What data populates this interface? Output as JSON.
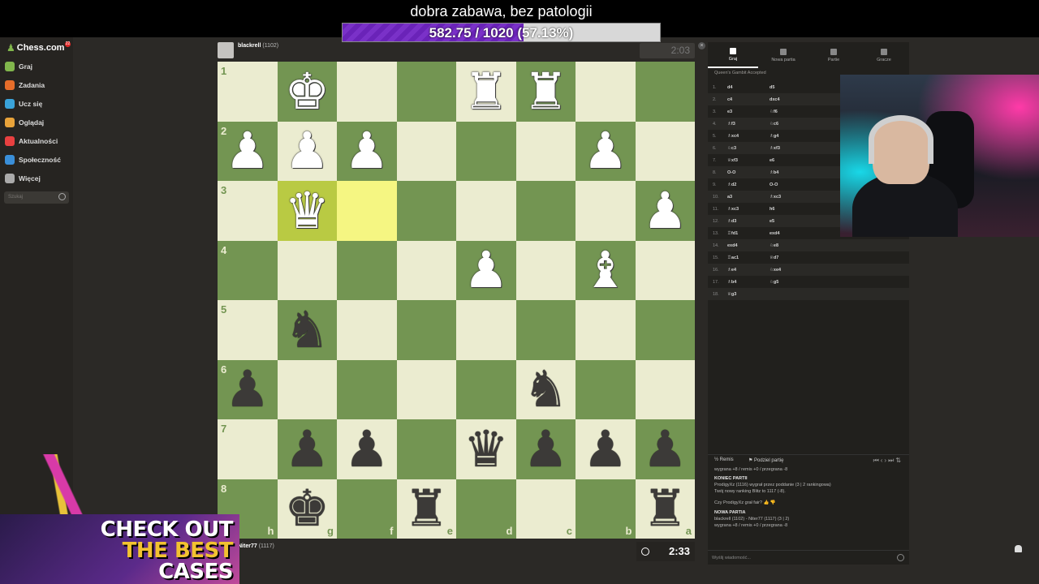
{
  "banner": {
    "title": "dobra zabawa, bez patologii",
    "goal_text": "582.75 / 1020",
    "goal_percent_label": "(57.13%)",
    "goal_fraction": 0.5713,
    "fill_color": "#6a23b8"
  },
  "sidebar": {
    "logo": "Chess.com",
    "badge": "22",
    "items": [
      {
        "label": "Graj",
        "icon": "pawn-icon",
        "color": "#81b64c"
      },
      {
        "label": "Zadania",
        "icon": "puzzle-icon",
        "color": "#e66d2a"
      },
      {
        "label": "Ucz się",
        "icon": "lesson-icon",
        "color": "#3aa3d9"
      },
      {
        "label": "Oglądaj",
        "icon": "watch-icon",
        "color": "#e8a33a"
      },
      {
        "label": "Aktualności",
        "icon": "news-icon",
        "color": "#e84040"
      },
      {
        "label": "Społeczność",
        "icon": "community-icon",
        "color": "#3a8fd9"
      },
      {
        "label": "Więcej",
        "icon": "more-icon",
        "color": "#aaaaaa"
      }
    ],
    "search_placeholder": "Szukaj"
  },
  "top_player": {
    "name": "blackrell",
    "rating": "(1102)",
    "clock": "2:03"
  },
  "bottom_player": {
    "name": "Niter77",
    "rating": "(1117)",
    "clock": "2:33"
  },
  "board": {
    "ranks": [
      "1",
      "2",
      "3",
      "4",
      "5",
      "6",
      "7",
      "8"
    ],
    "files": [
      "h",
      "g",
      "f",
      "e",
      "d",
      "c",
      "b",
      "a"
    ],
    "highlighted": [
      [
        2,
        1
      ],
      [
        2,
        2
      ]
    ],
    "position": [
      [
        "",
        "wK",
        "",
        "",
        "wR",
        "wR",
        "",
        ""
      ],
      [
        "wP",
        "wP",
        "wP",
        "",
        "",
        "",
        "wP",
        ""
      ],
      [
        "",
        "wQ",
        "",
        "",
        "",
        "",
        "",
        "wP"
      ],
      [
        "",
        "",
        "",
        "",
        "wP",
        "",
        "wB",
        ""
      ],
      [
        "",
        "bN",
        "",
        "",
        "",
        "",
        "",
        ""
      ],
      [
        "bP",
        "",
        "",
        "",
        "",
        "bN",
        "",
        ""
      ],
      [
        "",
        "bP",
        "bP",
        "",
        "bQ",
        "bP",
        "bP",
        "bP"
      ],
      [
        "",
        "bK",
        "",
        "bR",
        "",
        "",
        "",
        "bR"
      ]
    ]
  },
  "panel": {
    "tabs": [
      {
        "label": "Graj",
        "icon": "bolt-icon"
      },
      {
        "label": "Nowa partia",
        "icon": "plus-icon"
      },
      {
        "label": "Partie",
        "icon": "games-icon"
      },
      {
        "label": "Gracze",
        "icon": "players-icon"
      }
    ],
    "opening": "Queen's Gambit Accepted",
    "moves": [
      {
        "n": "1.",
        "w": "d4",
        "b": "d5"
      },
      {
        "n": "2.",
        "w": "c4",
        "b": "dxc4"
      },
      {
        "n": "3.",
        "w": "e3",
        "b": "♘f6"
      },
      {
        "n": "4.",
        "w": "♗f3",
        "b": "♘c6"
      },
      {
        "n": "5.",
        "w": "♗xc4",
        "b": "♗g4"
      },
      {
        "n": "6.",
        "w": "♘c3",
        "b": "♗xf3"
      },
      {
        "n": "7.",
        "w": "♕xf3",
        "b": "e6"
      },
      {
        "n": "8.",
        "w": "O-O",
        "b": "♗b4"
      },
      {
        "n": "9.",
        "w": "♗d2",
        "b": "O-O"
      },
      {
        "n": "10.",
        "w": "a3",
        "b": "♗xc3"
      },
      {
        "n": "11.",
        "w": "♗xc3",
        "b": "h6"
      },
      {
        "n": "12.",
        "w": "♗d3",
        "b": "e5"
      },
      {
        "n": "13.",
        "w": "♖fd1",
        "b": "exd4"
      },
      {
        "n": "14.",
        "w": "exd4",
        "b": "♘e8"
      },
      {
        "n": "15.",
        "w": "♖ac1",
        "b": "♕d7"
      },
      {
        "n": "16.",
        "w": "♗e4",
        "b": "♘xe4"
      },
      {
        "n": "17.",
        "w": "♗b4",
        "b": "♘g5"
      },
      {
        "n": "18.",
        "w": "♕g3",
        "b": ""
      }
    ],
    "remis_label": "Remis",
    "share_label": "Podziel partię",
    "chat": {
      "l1": "wygrana +8 / remis +0 / przegrana -8",
      "l2": "KONIEC PARTII",
      "l3": "ProdigyXz (1116) wygrał przez poddanie (3 | 2 rankingowa)",
      "l4": "Twój nowy ranking Blitz to 1117 (-8).",
      "l5": "Czy ProdigyXz grał fair?",
      "l6": "NOWA PARTIA",
      "l7": "blackrell (1102) - Niter77 (1117) (3 | 2)",
      "l8": "wygrana +8 / remis +0 / przegrana -8"
    },
    "chat_placeholder": "Wyślij wiadomość..."
  },
  "ad": {
    "line1": "CHECK OUT",
    "line2": "THE BEST",
    "line3": "CASES"
  }
}
